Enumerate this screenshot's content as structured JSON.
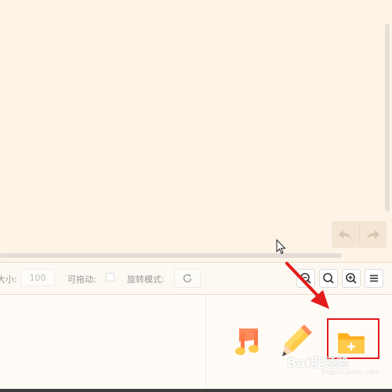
{
  "toolbar": {
    "size_label": "大小:",
    "size_value": "100",
    "draggable_label": "可拖动:",
    "rotate_label": "旋转模式:"
  },
  "icons": {
    "undo": "undo-icon",
    "redo": "redo-icon",
    "rotate": "rotate-icon",
    "zoom_out": "zoom-out-icon",
    "zoom_reset": "zoom-reset-icon",
    "zoom_in": "zoom-in-icon",
    "menu": "menu-icon",
    "music": "music-note-icon",
    "edit": "pencil-icon",
    "add_folder": "folder-add-icon"
  },
  "watermark": {
    "text": "Bai度经验",
    "sub": "jingyan.baidu.com"
  },
  "colors": {
    "canvas_bg": "#fdf3e7",
    "panel_bg": "#fffcf8",
    "highlight": "#e31b1b",
    "folder": "#ffc94a",
    "music": "#ff8a5b"
  }
}
